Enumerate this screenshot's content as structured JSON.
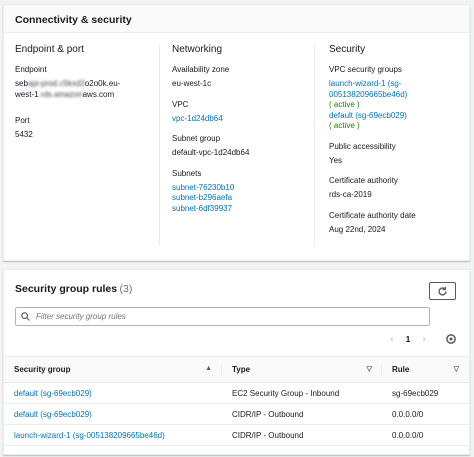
{
  "connectivity": {
    "title": "Connectivity & security",
    "endpoint_col": {
      "title": "Endpoint & port",
      "endpoint_label": "Endpoint",
      "endpoint_value": "sebapi-prod.c5kxd2o2o0k.eu-west-1.rds.amazonaws.com",
      "port_label": "Port",
      "port_value": "5432"
    },
    "networking_col": {
      "title": "Networking",
      "az_label": "Availability zone",
      "az_value": "eu-west-1c",
      "vpc_label": "VPC",
      "vpc_value": "vpc-1d24db64",
      "subnet_group_label": "Subnet group",
      "subnet_group_value": "default-vpc-1d24db64",
      "subnets_label": "Subnets",
      "subnets": [
        "subnet-76230b10",
        "subnet-b296aefa",
        "subnet-6df39937"
      ]
    },
    "security_col": {
      "title": "Security",
      "vpc_sg_label": "VPC security groups",
      "vpc_sgs": [
        {
          "name": "launch-wizard-1 (sg-005138209665be46d)",
          "status": "( active )"
        },
        {
          "name": "default (sg-69ecb029)",
          "status": "( active )"
        }
      ],
      "public_label": "Public accessibility",
      "public_value": "Yes",
      "ca_label": "Certificate authority",
      "ca_value": "rds-ca-2019",
      "ca_date_label": "Certificate authority date",
      "ca_date_value": "Aug 22nd, 2024"
    }
  },
  "sg_rules": {
    "title": "Security group rules",
    "count": "(3)",
    "search_placeholder": "Filter security group rules",
    "page": "1",
    "columns": [
      "Security group",
      "Type",
      "Rule"
    ],
    "rows": [
      {
        "group": "default (sg-69ecb029)",
        "type": "EC2 Security Group - Inbound",
        "rule": "sg-69ecb029"
      },
      {
        "group": "default (sg-69ecb029)",
        "type": "CIDR/IP - Outbound",
        "rule": "0.0.0.0/0"
      },
      {
        "group": "launch-wizard-1 (sg-005138209665be46d)",
        "type": "CIDR/IP - Outbound",
        "rule": "0.0.0.0/0"
      }
    ]
  },
  "icons": {
    "refresh": "refresh-icon",
    "search": "search-icon",
    "prev": "chevron-left-icon",
    "next": "chevron-right-icon",
    "settings": "gear-icon",
    "sort_asc": "sort-ascending-icon",
    "sort": "sort-icon"
  },
  "colors": {
    "link": "#0073bb",
    "active": "#1d8102",
    "text": "#16191f",
    "background": "#f2f3f3"
  }
}
